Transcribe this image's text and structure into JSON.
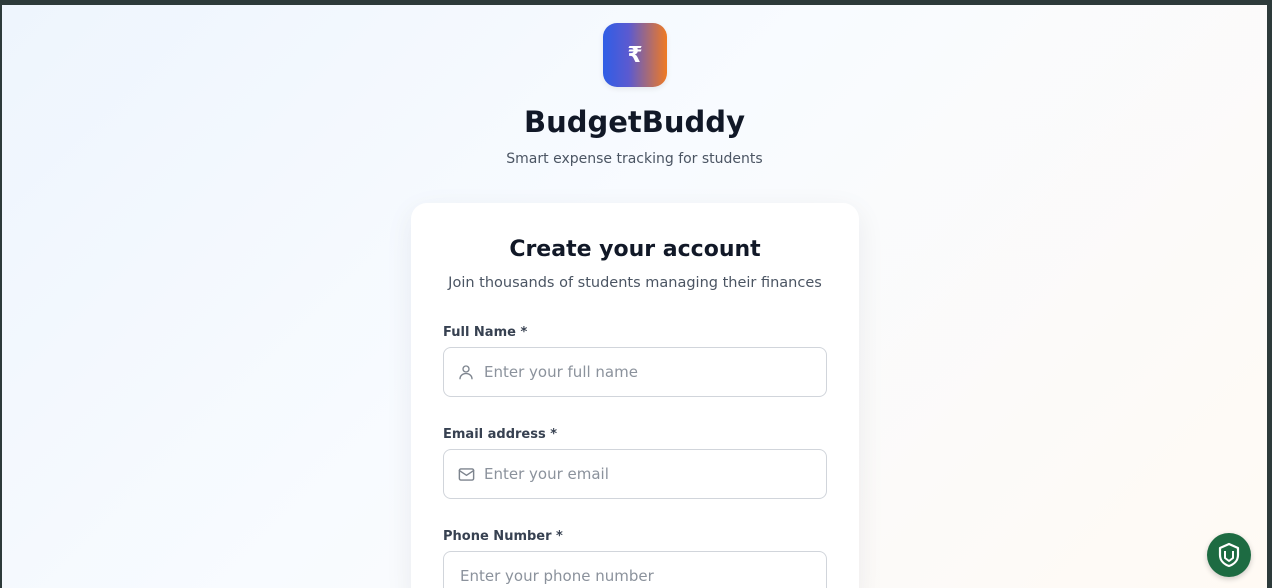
{
  "brand": {
    "logo_symbol": "₹",
    "title": "BudgetBuddy",
    "subtitle": "Smart expense tracking for students",
    "logo_gradient": [
      "#2f5ee6",
      "#f07a22"
    ]
  },
  "signup_card": {
    "title": "Create your account",
    "subtitle": "Join thousands of students managing their finances",
    "fields": [
      {
        "label": "Full Name *",
        "placeholder": "Enter your full name",
        "value": "",
        "icon": "user-icon"
      },
      {
        "label": "Email address *",
        "placeholder": "Enter your email",
        "value": "",
        "icon": "mail-icon"
      },
      {
        "label": "Phone Number *",
        "placeholder": "Enter your phone number",
        "value": "",
        "icon": ""
      }
    ]
  },
  "floating_widget": {
    "icon": "shield-check-icon",
    "color": "#1d6b42"
  }
}
